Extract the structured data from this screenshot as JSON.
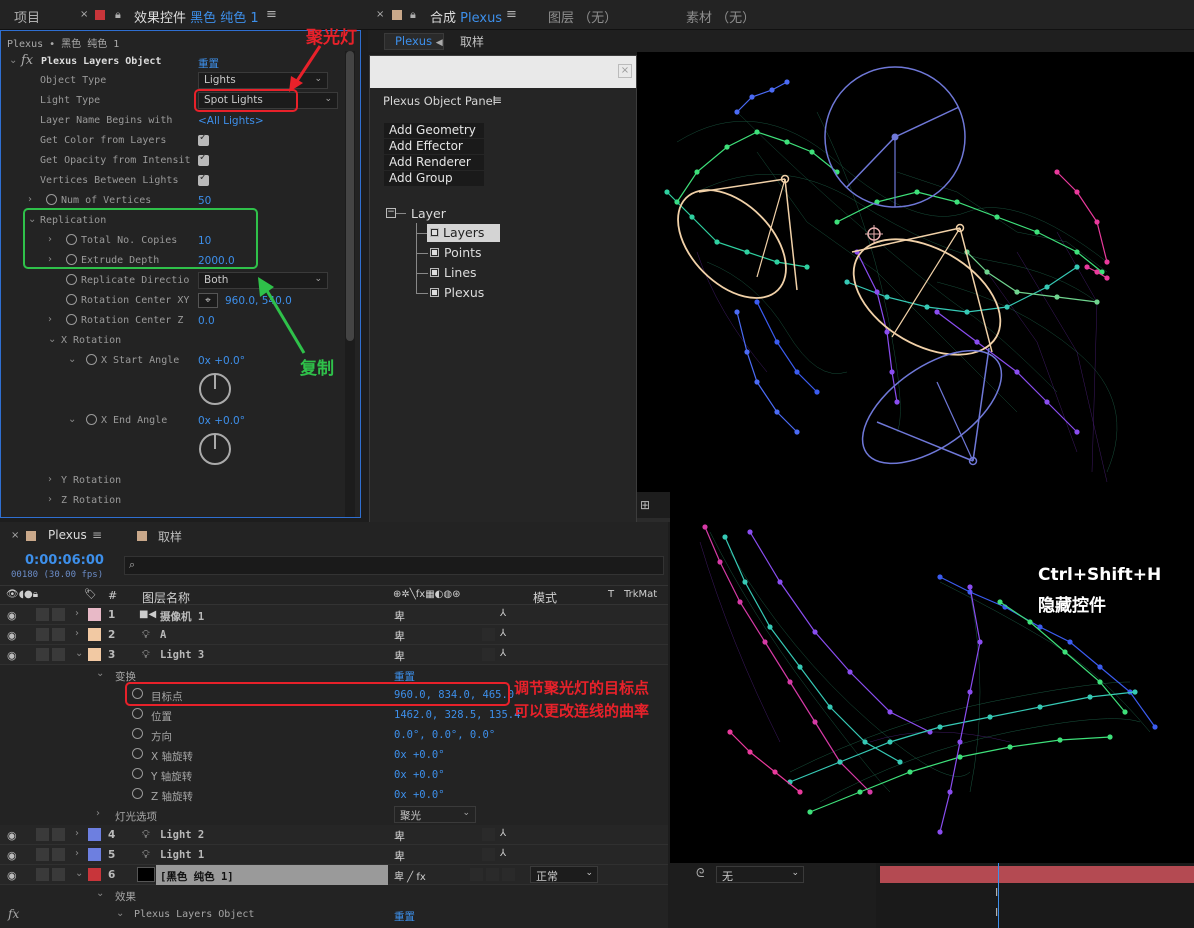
{
  "top": {
    "project_tab": "项目",
    "fx_tab_prefix": "效果控件",
    "fx_tab_layer": "黑色 纯色 1",
    "comp_tab_prefix": "合成",
    "comp_tab_name": "Plexus",
    "layers_tab": "图层 （无）",
    "footage_tab": "素材 （无）",
    "comp_subtab_plexus": "Plexus",
    "comp_subtab_sample": "取样"
  },
  "effect_controls": {
    "breadcrumb": "Plexus • 黑色 纯色 1",
    "effect_name": "Plexus Layers Object",
    "reset": "重置",
    "object_type_label": "Object Type",
    "object_type_value": "Lights",
    "light_type_label": "Light Type",
    "light_type_value": "Spot Lights",
    "layer_name_label": "Layer Name Begins with",
    "layer_name_value": "<All Lights>",
    "get_color_label": "Get Color from Layers",
    "get_opacity_label": "Get Opacity from Intensit",
    "vertices_between_label": "Vertices Between Lights",
    "num_vertices_label": "Num of Vertices",
    "num_vertices_value": "50",
    "replication_label": "Replication",
    "total_copies_label": "Total No. Copies",
    "total_copies_value": "10",
    "extrude_depth_label": "Extrude Depth",
    "extrude_depth_value": "2000.0",
    "replicate_dir_label": "Replicate Directio",
    "replicate_dir_value": "Both",
    "rotation_center_xy_label": "Rotation Center XY",
    "rotation_center_xy_value": "960.0, 540.0",
    "rotation_center_z_label": "Rotation Center Z",
    "rotation_center_z_value": "0.0",
    "x_rotation_label": "X Rotation",
    "x_start_label": "X Start Angle",
    "x_start_value": "0x +0.0°",
    "x_end_label": "X End Angle",
    "x_end_value": "0x +0.0°",
    "y_rotation_label": "Y Rotation",
    "z_rotation_label": "Z Rotation"
  },
  "plexus_panel": {
    "title": "Plexus Object Panel",
    "buttons": [
      "Add Geometry",
      "Add Effector",
      "Add Renderer",
      "Add Group"
    ],
    "tree_root": "Layer",
    "tree_items": [
      "Layers",
      "Points",
      "Lines",
      "Plexus"
    ]
  },
  "timeline": {
    "tab_plexus": "Plexus",
    "tab_sample": "取样",
    "timecode": "0:00:06:00",
    "frames": "00180 (30.00 fps)",
    "search_placeholder": "",
    "col_layer_name": "图层名称",
    "col_mode": "模式",
    "col_t": "T",
    "col_trkmat": "TrkMat",
    "layers": [
      {
        "num": "1",
        "name": "摄像机 1",
        "color": "#e8b9c7"
      },
      {
        "num": "2",
        "name": "A",
        "color": "#f2c9a3"
      },
      {
        "num": "3",
        "name": "Light 3",
        "color": "#f2c9a3"
      }
    ],
    "transform_label": "变换",
    "transform_reset": "重置",
    "props": [
      {
        "label": "目标点",
        "value": "960.0, 834.0, 465.0"
      },
      {
        "label": "位置",
        "value": "1462.0, 328.5, 135.4"
      },
      {
        "label": "方向",
        "value": "0.0°, 0.0°, 0.0°"
      },
      {
        "label": "X 轴旋转",
        "value": "0x +0.0°"
      },
      {
        "label": "Y 轴旋转",
        "value": "0x +0.0°"
      },
      {
        "label": "Z 轴旋转",
        "value": "0x +0.0°"
      }
    ],
    "light_options_label": "灯光选项",
    "light_options_value": "聚光",
    "layers2": [
      {
        "num": "4",
        "name": "Light 2",
        "color": "#6d7fe0"
      },
      {
        "num": "5",
        "name": "Light 1",
        "color": "#6d7fe0"
      },
      {
        "num": "6",
        "name": "[黑色 纯色 1]",
        "color": "#c8353a"
      }
    ],
    "mode_value": "正常",
    "trkmat_value": "无",
    "effects_label": "效果",
    "effect_item": "Plexus Layers Object",
    "effect_reset": "重置"
  },
  "annotations": {
    "spotlight": "聚光灯",
    "copy": "复制",
    "hide_controls_1": "Ctrl+Shift+H",
    "hide_controls_2": "隐藏控件",
    "target_point_1": "调节聚光灯的目标点",
    "target_point_2": "可以更改连线的曲率"
  },
  "colors": {
    "accent": "#3d8fea",
    "red_annotation": "#e8212a",
    "green_annotation": "#2fc14a"
  }
}
